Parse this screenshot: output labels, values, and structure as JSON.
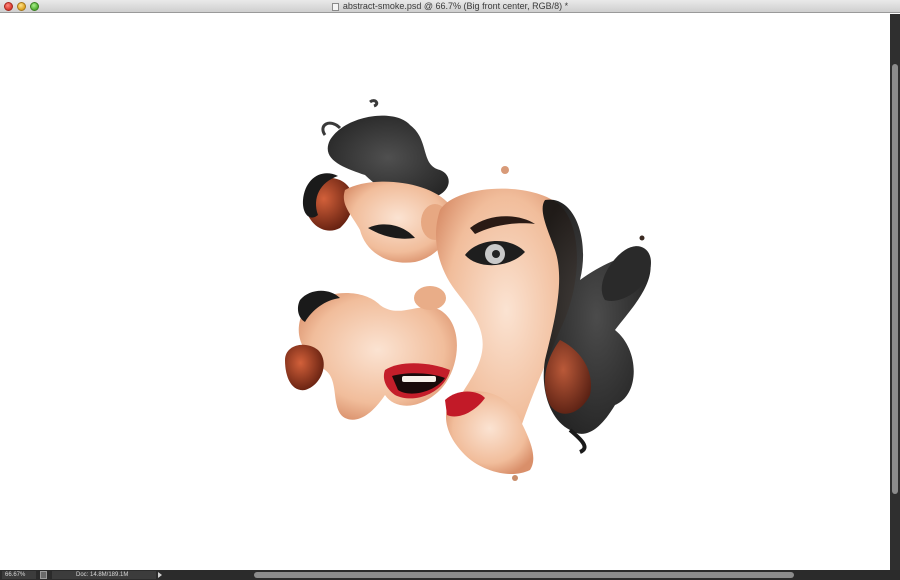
{
  "window": {
    "title": "abstract-smoke.psd @ 66.7% (Big front center, RGB/8) *"
  },
  "artwork": {
    "description_icon": "abstract-smoke-portrait-artwork"
  },
  "status": {
    "zoom": "66.67%",
    "doc_info": "Doc: 14.8M/189.1M"
  },
  "colors": {
    "canvas": "#ffffff",
    "skin": "#f2c4a4",
    "lips": "#c41e2a",
    "smoke": "#1c1c1c",
    "hair": "#a23a18"
  }
}
